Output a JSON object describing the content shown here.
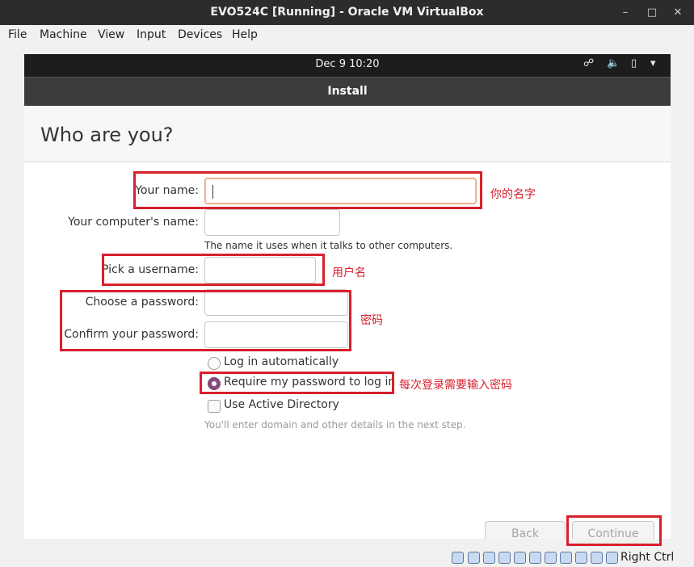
{
  "window": {
    "title": "EVO524C [Running] - Oracle VM VirtualBox",
    "minimize": "–",
    "maximize": "□",
    "close": "✕"
  },
  "menubar": [
    "File",
    "Machine",
    "View",
    "Input",
    "Devices",
    "Help"
  ],
  "guest_topbar": {
    "clock": "Dec 9  10:20",
    "network_icon": "☍",
    "volume_icon": "🔈",
    "battery_icon": "▯",
    "menu_icon": "▾"
  },
  "installer": {
    "header_title": "Install",
    "page_title": "Who are you?",
    "fields": {
      "name_label": "Your name:",
      "name_value": "",
      "computer_label": "Your computer's name:",
      "computer_value": "",
      "computer_hint": "The name it uses when it talks to other computers.",
      "username_label": "Pick a username:",
      "username_value": "",
      "password_label": "Choose a password:",
      "password_value": "",
      "confirm_label": "Confirm your password:",
      "confirm_value": ""
    },
    "options": {
      "auto_login": "Log in automatically",
      "require_password": "Require my password to log in",
      "active_directory": "Use Active Directory",
      "ad_hint": "You'll enter domain and other details in the next step."
    },
    "buttons": {
      "back": "Back",
      "continue": "Continue"
    }
  },
  "annotations": {
    "name_note": "你的名字",
    "username_note": "用户名",
    "password_note": "密码",
    "require_note": "每次登录需要输入密码"
  },
  "statusbar": {
    "host_key": "Right Ctrl"
  },
  "colors": {
    "annotation_red": "#d8202c",
    "radio_selected": "#8a4b7f",
    "focus_border": "#e9a17a"
  }
}
